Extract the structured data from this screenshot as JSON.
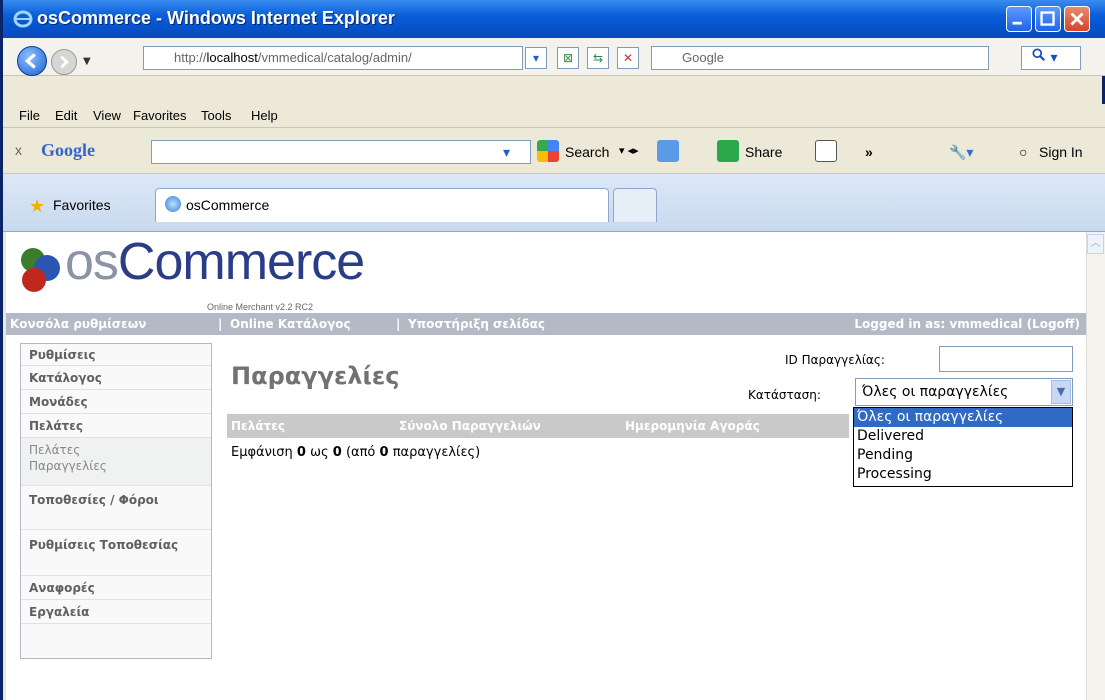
{
  "window": {
    "title": "osCommerce - Windows Internet Explorer"
  },
  "address": {
    "url_prefix": "http://",
    "url_host": "localhost",
    "url_path": "/vmmedical/catalog/admin/"
  },
  "search_box": {
    "placeholder": "Google"
  },
  "menu": {
    "items": [
      "File",
      "Edit",
      "View",
      "Favorites",
      "Tools",
      "Help"
    ]
  },
  "google_toolbar": {
    "close": "x",
    "brand": "Google",
    "search_label": "Search",
    "share_label": "Share",
    "more_label": "»",
    "signin_label": "Sign In"
  },
  "favorites": {
    "label": "Favorites"
  },
  "tab": {
    "title": "osCommerce"
  },
  "logo": {
    "os_part": "os",
    "commerce_part": "Commerce",
    "subtitle": "Online Merchant v2.2 RC2"
  },
  "header_nav": {
    "links": [
      "Κονσόλα ρυθμίσεων",
      "Online Κατάλογος",
      "Υποστήριξη σελίδας"
    ],
    "separator": "|",
    "logged_in": "Logged in as: vmmedical (Logoff)"
  },
  "sidebar": {
    "items": [
      "Ρυθμίσεις",
      "Κατάλογος",
      "Μονάδες",
      "Πελάτες"
    ],
    "sub_items": [
      "Πελάτες",
      "Παραγγελίες"
    ],
    "items_after": [
      "Τοποθεσίες / Φόροι",
      "Ρυθμίσεις Τοποθεσίας",
      "Αναφορές",
      "Εργαλεία"
    ]
  },
  "page": {
    "title": "Παραγγελίες"
  },
  "filters": {
    "order_id_label": "ID Παραγγελίας:",
    "status_label": "Κατάσταση:",
    "status_selected": "Όλες οι παραγγελίες",
    "status_options": [
      "Όλες οι παραγγελίες",
      "Delivered",
      "Pending",
      "Processing"
    ]
  },
  "table": {
    "headers": [
      "Πελάτες",
      "Σύνολο Παραγγελιών",
      "Ημερομηνία Αγοράς"
    ]
  },
  "summary": {
    "prefix": "Εμφάνιση",
    "from": "0",
    "to_word": "ως",
    "to": "0",
    "of_open": "(από",
    "total": "0",
    "of_close": "παραγγελίες)"
  },
  "colors": {
    "accent": "#316AC5",
    "nav_bar": "#B3BAC5",
    "title_bar": "#0553CD"
  }
}
